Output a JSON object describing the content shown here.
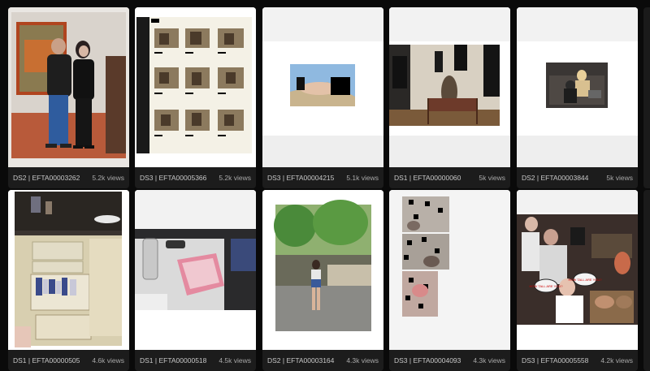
{
  "cards": [
    {
      "code": "DS2 | EFTA00003262",
      "views": "5.2k views"
    },
    {
      "code": "DS3 | EFTA00005366",
      "views": "5.2k views"
    },
    {
      "code": "DS3 | EFTA00004215",
      "views": "5.1k views"
    },
    {
      "code": "DS1 | EFTA00000060",
      "views": "5k views"
    },
    {
      "code": "DS2 | EFTA00003844",
      "views": "5k views"
    },
    {
      "code": "DS1 | EFTA00000505",
      "views": "4.6k views"
    },
    {
      "code": "DS1 | EFTA00000518",
      "views": "4.5k views"
    },
    {
      "code": "DS2 | EFTA00003164",
      "views": "4.3k views"
    },
    {
      "code": "DS3 | EFTA00004093",
      "views": "4.3k views"
    },
    {
      "code": "DS3 | EFTA00005558",
      "views": "4.2k views"
    }
  ],
  "photo_text": {
    "sign_left": "HOW TALL ARE YOU?",
    "sign_right": "HOW TALL ARE YOU?"
  }
}
